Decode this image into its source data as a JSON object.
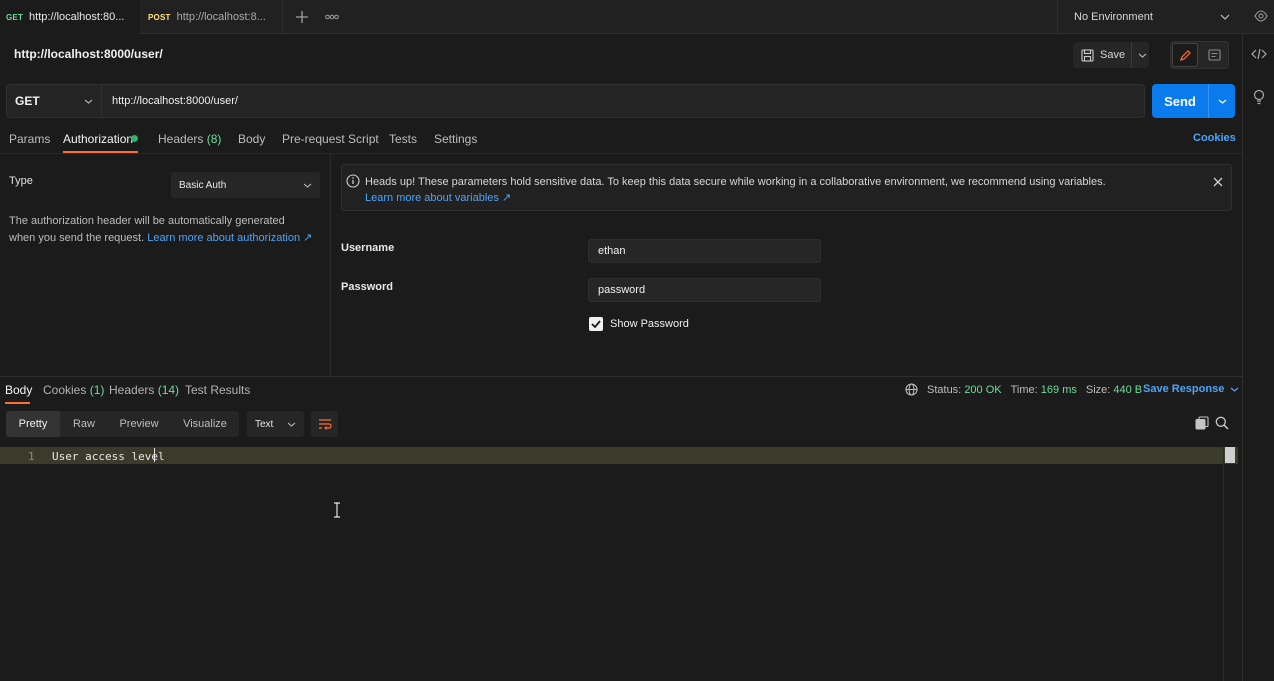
{
  "tabs": [
    {
      "method": "GET",
      "title": "http://localhost:80..."
    },
    {
      "method": "POST",
      "title": "http://localhost:8..."
    }
  ],
  "environment": {
    "label": "No Environment"
  },
  "request": {
    "title": "http://localhost:8000/user/",
    "method": "GET",
    "url": "http://localhost:8000/user/",
    "save_label": "Save",
    "send_label": "Send"
  },
  "request_tabs": {
    "params": "Params",
    "authorization": "Authorization",
    "headers": "Headers",
    "headers_count": "(8)",
    "body": "Body",
    "prerequest": "Pre-request Script",
    "tests": "Tests",
    "settings": "Settings",
    "cookies": "Cookies"
  },
  "auth": {
    "type_label": "Type",
    "type_value": "Basic Auth",
    "description": "The authorization header will be automatically generated when you send the request.",
    "learn_link": "Learn more about authorization ↗",
    "banner_text": "Heads up! These parameters hold sensitive data. To keep this data secure while working in a collaborative environment, we recommend using variables.",
    "banner_link": "Learn more about variables ↗",
    "username_label": "Username",
    "username_value": "ethan",
    "password_label": "Password",
    "password_value": "password",
    "show_password_label": "Show Password"
  },
  "response": {
    "tabs": {
      "body": "Body",
      "cookies": "Cookies",
      "cookies_count": "(1)",
      "headers": "Headers",
      "headers_count": "(14)",
      "test_results": "Test Results"
    },
    "status_label": "Status:",
    "status_value": "200 OK",
    "time_label": "Time:",
    "time_value": "169 ms",
    "size_label": "Size:",
    "size_value": "440 B",
    "save_response": "Save Response",
    "views": [
      "Pretty",
      "Raw",
      "Preview",
      "Visualize"
    ],
    "format": "Text",
    "line_number": "1",
    "content": "User access level"
  },
  "colors": {
    "accent": "#ff6c37",
    "send": "#097bed",
    "link": "#4fa3f7",
    "success": "#6bdd9a"
  }
}
